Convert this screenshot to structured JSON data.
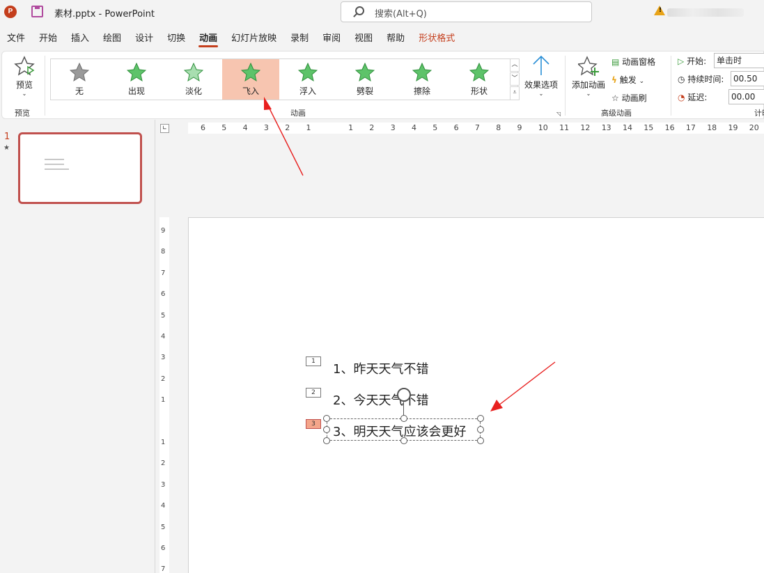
{
  "app": {
    "icon_letter": "P",
    "doc_title": "素材.pptx  -  PowerPoint",
    "search_placeholder": "搜索(Alt+Q)",
    "warning_mark": "!"
  },
  "tabs": [
    {
      "label": "文件"
    },
    {
      "label": "开始"
    },
    {
      "label": "插入"
    },
    {
      "label": "绘图"
    },
    {
      "label": "设计"
    },
    {
      "label": "切换"
    },
    {
      "label": "动画",
      "active": true
    },
    {
      "label": "幻灯片放映"
    },
    {
      "label": "录制"
    },
    {
      "label": "审阅"
    },
    {
      "label": "视图"
    },
    {
      "label": "帮助"
    },
    {
      "label": "形状格式",
      "contextual": true
    }
  ],
  "ribbon": {
    "preview": {
      "label": "预览",
      "group": "预览"
    },
    "animation_group": "动画",
    "gallery": [
      {
        "label": "无",
        "style": "gray"
      },
      {
        "label": "出现",
        "style": "green"
      },
      {
        "label": "淡化",
        "style": "green-light"
      },
      {
        "label": "飞入",
        "style": "green",
        "selected": true
      },
      {
        "label": "浮入",
        "style": "green"
      },
      {
        "label": "劈裂",
        "style": "green"
      },
      {
        "label": "擦除",
        "style": "green"
      },
      {
        "label": "形状",
        "style": "green"
      }
    ],
    "effect_options": "效果选项",
    "advanced_group": "高级动画",
    "add_animation": "添加动画",
    "animation_pane": "动画窗格",
    "trigger": "触发",
    "painter": "动画刷",
    "timing": {
      "start_label": "开始:",
      "start_value": "单击时",
      "duration_label": "持续时间:",
      "duration_value": "00.50",
      "delay_label": "延迟:",
      "delay_value": "00.00",
      "group": "计时"
    }
  },
  "sidebar": {
    "slide_number": "1",
    "star": "★"
  },
  "rulers": {
    "horizontal": [
      "6",
      "5",
      "4",
      "3",
      "2",
      "1",
      "",
      "1",
      "2",
      "3",
      "4",
      "5",
      "6",
      "7",
      "8",
      "9",
      "10",
      "11",
      "12",
      "13",
      "14",
      "15",
      "16",
      "17",
      "18",
      "19",
      "20"
    ],
    "vertical": [
      "9",
      "8",
      "7",
      "6",
      "5",
      "4",
      "3",
      "2",
      "1",
      "",
      "1",
      "2",
      "3",
      "4",
      "5",
      "6",
      "7"
    ]
  },
  "slide": {
    "items": [
      {
        "tag": "1",
        "text": "1、昨天天气不错"
      },
      {
        "tag": "2",
        "text": "2、今天天气不错"
      },
      {
        "tag": "3",
        "text": "3、明天天气应该会更好",
        "selected": true
      }
    ]
  },
  "colors": {
    "accent": "#c43e1c",
    "selected_gallery": "#f7c5b0",
    "arrow": "#e8201f"
  }
}
